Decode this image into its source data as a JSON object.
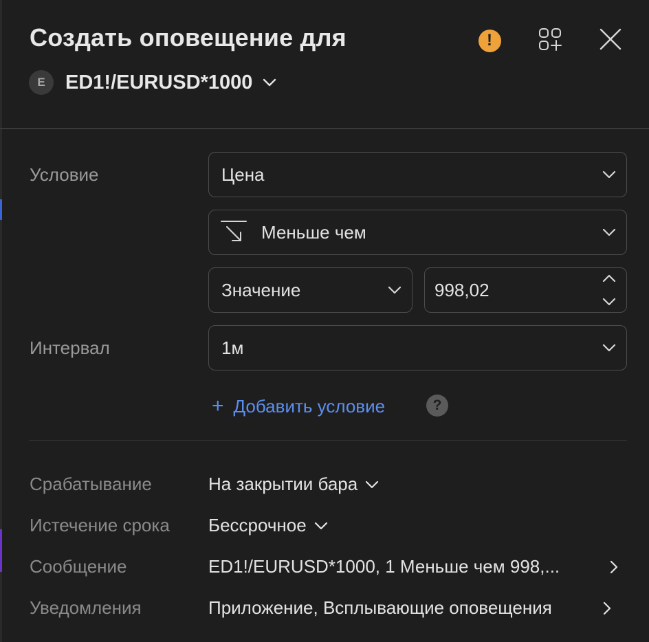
{
  "header": {
    "title": "Создать оповещение для",
    "symbol_badge": "E",
    "symbol": "ED1!/EURUSD*1000"
  },
  "icons": {
    "warning": "warning-icon",
    "apps": "add-widget-icon",
    "close": "close-icon"
  },
  "colors": {
    "background": "#1e1e1e",
    "accent": "#5b8ff0",
    "warning": "#f0a23a"
  },
  "condition": {
    "label": "Условие",
    "source_value": "Цена",
    "operator_value": "Меньше чем",
    "value_type": "Значение",
    "value": "998,02"
  },
  "interval": {
    "label": "Интервал",
    "value": "1м"
  },
  "add_condition_label": "Добавить условие",
  "help_glyph": "?",
  "settings": {
    "trigger": {
      "label": "Срабатывание",
      "value": "На закрытии бара"
    },
    "expiration": {
      "label": "Истечение срока",
      "value": "Бессрочное"
    },
    "message": {
      "label": "Сообщение",
      "value": "ED1!/EURUSD*1000, 1 Меньше чем 998,..."
    },
    "notifications": {
      "label": "Уведомления",
      "value": "Приложение, Всплывающие оповещения"
    }
  }
}
